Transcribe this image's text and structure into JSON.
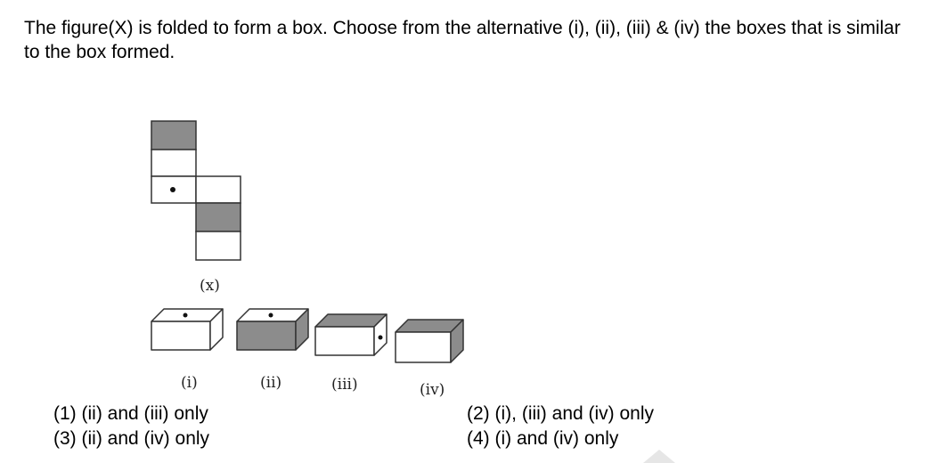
{
  "question": {
    "text": "The figure(X) is folded to form a box. Choose from the alternative (i), (ii), (iii) & (iv) the boxes that is similar to the box formed."
  },
  "figure": {
    "net_label": "(x)",
    "shade_color": "#8c8c8c",
    "boxes": [
      {
        "label": "(i)"
      },
      {
        "label": "(ii)"
      },
      {
        "label": "(iii)"
      },
      {
        "label": "(iv)"
      }
    ]
  },
  "options": [
    {
      "text": "(1) (ii) and (iii) only"
    },
    {
      "text": "(2) (i), (iii) and (iv) only"
    },
    {
      "text": "(3) (ii) and (iv) only"
    },
    {
      "text": "(4) (i) and (iv) only"
    }
  ]
}
